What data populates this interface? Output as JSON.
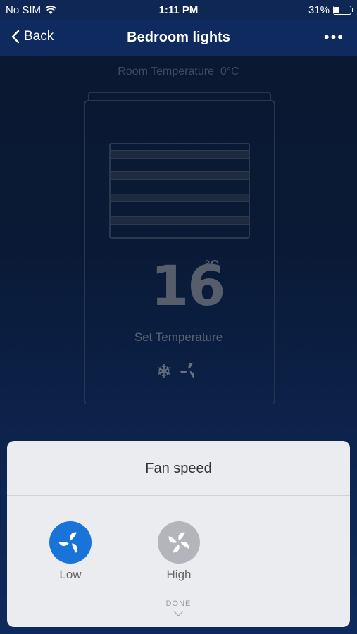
{
  "status_bar": {
    "carrier": "No SIM",
    "time": "1:11 PM",
    "battery": "31%",
    "battery_level": 0.31
  },
  "nav": {
    "back_label": "Back",
    "title": "Bedroom lights",
    "more_icon": "more-icon"
  },
  "device": {
    "room_temperature_label": "Room Temperature",
    "room_temperature_value": "0°C",
    "set_temperature_value": "16",
    "set_temperature_unit": "°C",
    "set_temperature_label": "Set Temperature",
    "mode_icons": [
      "snowflake-icon",
      "fan-icon"
    ]
  },
  "sheet": {
    "title": "Fan speed",
    "options": [
      {
        "label": "Low",
        "selected": true,
        "color": "#1a73d9",
        "icon": "fan-icon"
      },
      {
        "label": "High",
        "selected": false,
        "color": "#b3b5ba",
        "icon": "fan-icon"
      }
    ],
    "done_label": "DONE"
  }
}
